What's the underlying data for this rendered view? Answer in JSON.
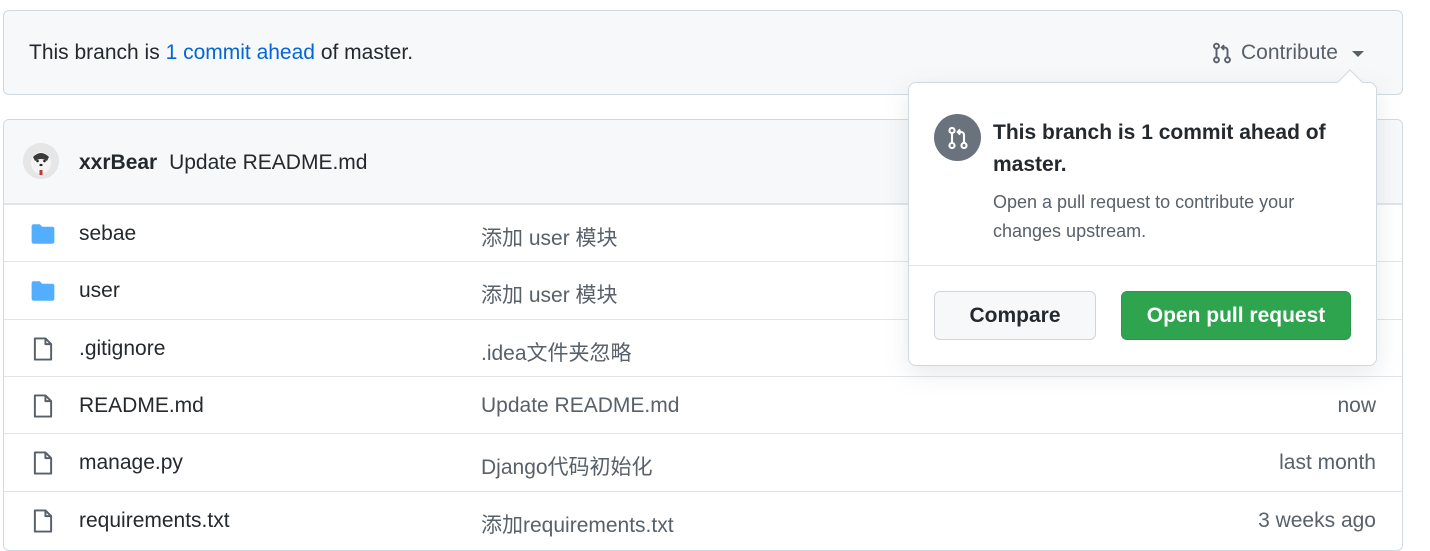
{
  "branch_bar": {
    "prefix": "This branch is ",
    "link": "1 commit ahead",
    "suffix": " of master.",
    "contribute_label": "Contribute"
  },
  "commit": {
    "author": "xxrBear",
    "message": "Update README.md"
  },
  "files": [
    {
      "type": "folder",
      "name": "sebae",
      "message": "添加 user 模块",
      "age": ""
    },
    {
      "type": "folder",
      "name": "user",
      "message": "添加 user 模块",
      "age": ""
    },
    {
      "type": "file",
      "name": ".gitignore",
      "message": ".idea文件夹忽略",
      "age": ""
    },
    {
      "type": "file",
      "name": "README.md",
      "message": "Update README.md",
      "age": "now"
    },
    {
      "type": "file",
      "name": "manage.py",
      "message": "Django代码初始化",
      "age": "last month"
    },
    {
      "type": "file",
      "name": "requirements.txt",
      "message": "添加requirements.txt",
      "age": "3 weeks ago"
    }
  ],
  "popover": {
    "title": "This branch is 1 commit ahead of master.",
    "description": "Open a pull request to contribute your changes upstream.",
    "compare_label": "Compare",
    "open_pr_label": "Open pull request"
  },
  "colors": {
    "link": "#0366d6",
    "folder": "#54aeff",
    "primary_button": "#2ea44f"
  },
  "icons": {
    "folder": "folder-icon",
    "file": "file-icon",
    "contribute": "git-pull-request-icon"
  }
}
